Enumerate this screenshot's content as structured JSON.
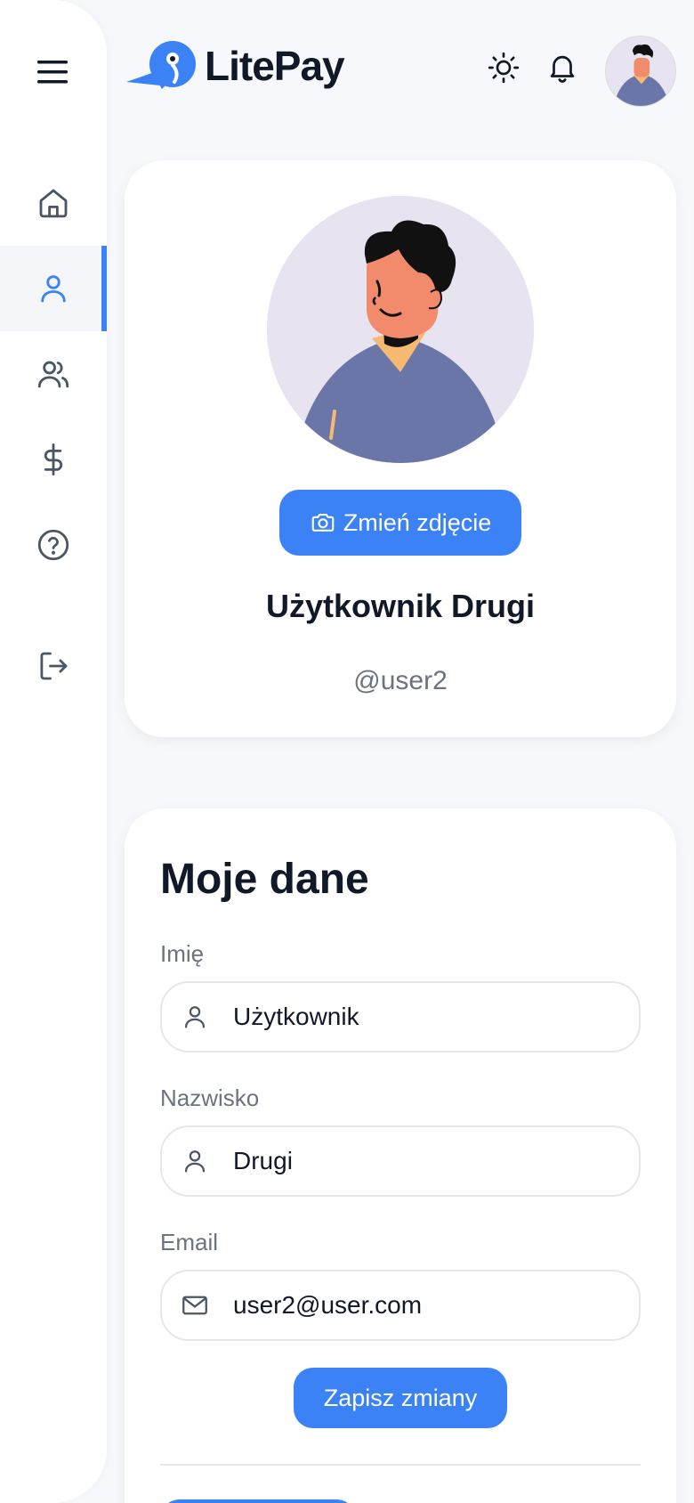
{
  "app": {
    "name": "LitePay",
    "accent_color": "#3b82f6"
  },
  "sidebar": {
    "menu_icon": "hamburger-menu-icon",
    "items": [
      {
        "id": "home",
        "icon": "home-icon",
        "active": false
      },
      {
        "id": "profile",
        "icon": "user-icon",
        "active": true
      },
      {
        "id": "contacts",
        "icon": "users-icon",
        "active": false
      },
      {
        "id": "payments",
        "icon": "dollar-icon",
        "active": false
      },
      {
        "id": "help",
        "icon": "help-circle-icon",
        "active": false
      },
      {
        "id": "logout",
        "icon": "logout-icon",
        "active": false
      }
    ]
  },
  "header": {
    "theme_icon": "sun-icon",
    "notifications_icon": "bell-icon"
  },
  "profile": {
    "change_photo_label": "Zmień zdjęcie",
    "full_name": "Użytkownik Drugi",
    "handle": "@user2"
  },
  "my_data": {
    "title": "Moje dane",
    "first_name_label": "Imię",
    "first_name_value": "Użytkownik",
    "last_name_label": "Nazwisko",
    "last_name_value": "Drugi",
    "email_label": "Email",
    "email_value": "user2@user.com",
    "save_label": "Zapisz zmiany"
  }
}
